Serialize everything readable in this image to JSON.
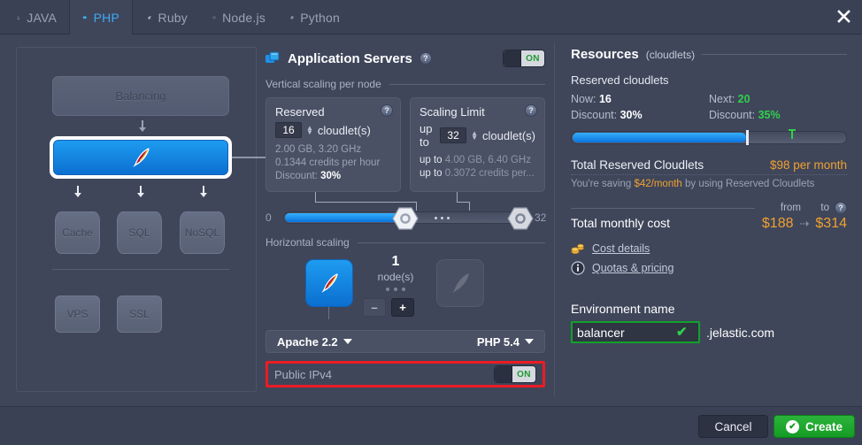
{
  "window": {
    "close_icon": "close-icon"
  },
  "tabs": [
    {
      "id": "java",
      "label": "JAVA",
      "icon": "java-duke-icon",
      "active": false
    },
    {
      "id": "php",
      "label": "PHP",
      "icon": "php-elephant-icon",
      "active": true
    },
    {
      "id": "ruby",
      "label": "Ruby",
      "icon": "ruby-gem-icon",
      "active": false
    },
    {
      "id": "nodejs",
      "label": "Node.js",
      "icon": "nodejs-hex-icon",
      "active": false
    },
    {
      "id": "python",
      "label": "Python",
      "icon": "python-snake-icon",
      "active": false
    }
  ],
  "topology": {
    "balancing_label": "Balancing",
    "selected_node_icon": "apache-feather-icon",
    "databases": [
      {
        "label": "Cache"
      },
      {
        "label": "SQL"
      },
      {
        "label": "NoSQL"
      }
    ],
    "extras": [
      {
        "label": "VPS"
      },
      {
        "label": "SSL"
      }
    ]
  },
  "app_servers": {
    "title": "Application Servers",
    "help_icon": "question-mark-icon",
    "toggle_state": "ON",
    "vertical_legend": "Vertical scaling per node",
    "reserved": {
      "title": "Reserved",
      "value": "16",
      "unit": "cloudlet(s)",
      "spec": "2.00 GB, 3.20 GHz",
      "credits": "0.1344 credits per hour",
      "discount_label": "Discount:",
      "discount_value": "30%"
    },
    "limit": {
      "title": "Scaling Limit",
      "prefix": "up to",
      "value": "32",
      "unit": "cloudlet(s)",
      "spec_prefix": "up to",
      "spec": "4.00 GB, 6.40 GHz",
      "credits_prefix": "up to",
      "credits": "0.3072 credits per..."
    },
    "slider": {
      "min_label": "0",
      "max_label": "32",
      "reserved_percent": 50,
      "limit_percent": 100
    },
    "horizontal_legend": "Horizontal scaling",
    "nodes": {
      "count": "1",
      "unit_label": "node(s)",
      "minus_label": "–",
      "plus_label": "+",
      "node_icon": "apache-feather-icon",
      "ghost_icon": "apache-feather-ghost-icon"
    },
    "stack": {
      "server": "Apache 2.2",
      "engine": "PHP 5.4"
    },
    "public_ipv4": {
      "label": "Public IPv4",
      "toggle_state": "ON",
      "highlight_color": "#ec1c24"
    }
  },
  "resources": {
    "title": "Resources",
    "subtitle": "(cloudlets)",
    "reserved_header": "Reserved cloudlets",
    "now_label": "Now:",
    "now_value": "16",
    "now_discount_label": "Discount:",
    "now_discount_value": "30%",
    "next_label": "Next:",
    "next_value": "20",
    "next_discount_label": "Discount:",
    "next_discount_value": "35%",
    "bar": {
      "fill_percent": 64,
      "next_marker_percent": 80
    },
    "total_reserved_label": "Total Reserved Cloudlets",
    "total_reserved_value": "$98 per month",
    "saving_prefix": "You're saving",
    "saving_value": "$42/month",
    "saving_suffix": "by using Reserved Cloudlets",
    "from_label": "from",
    "to_label": "to",
    "help_icon": "question-mark-icon",
    "total_cost_label": "Total monthly cost",
    "total_cost_from": "$188",
    "total_cost_arrow": "⇢",
    "total_cost_to": "$314",
    "links": [
      {
        "label": "Cost details",
        "icon": "coins-icon"
      },
      {
        "label": "Quotas & pricing",
        "icon": "info-icon"
      }
    ],
    "env_name_label": "Environment name",
    "env_name_value": "balancer",
    "env_name_placeholder": "environment name",
    "env_valid_icon": "check-icon",
    "env_domain": ".jelastic.com"
  },
  "footer": {
    "cancel_label": "Cancel",
    "create_label": "Create",
    "create_icon": "check-circle-icon"
  },
  "colors": {
    "accent_blue": "#0b6fd0",
    "green": "#2fd14a",
    "orange": "#f0a030",
    "highlight_red": "#ec1c24",
    "background": "#3f465a"
  }
}
